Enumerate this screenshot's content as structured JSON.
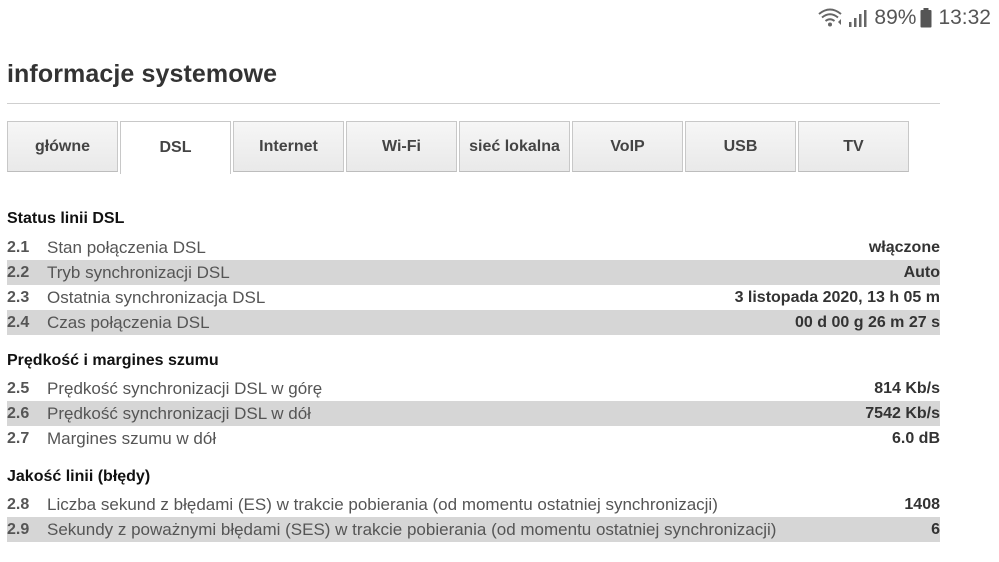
{
  "status_bar": {
    "battery_percent": "89%",
    "time": "13:32",
    "icons": [
      "wifi-icon",
      "signal-icon",
      "battery-icon"
    ]
  },
  "page": {
    "title": "informacje systemowe"
  },
  "tabs": [
    {
      "label": "główne"
    },
    {
      "label": "DSL"
    },
    {
      "label": "Internet"
    },
    {
      "label": "Wi-Fi"
    },
    {
      "label": "sieć lokalna"
    },
    {
      "label": "VoIP"
    },
    {
      "label": "USB"
    },
    {
      "label": "TV"
    }
  ],
  "active_tab": "DSL",
  "sections": [
    {
      "heading": "Status linii DSL",
      "rows": [
        {
          "num": "2.1",
          "label": "Stan połączenia DSL",
          "value": "włączone"
        },
        {
          "num": "2.2",
          "label": "Tryb synchronizacji DSL",
          "value": "Auto"
        },
        {
          "num": "2.3",
          "label": "Ostatnia synchronizacja DSL",
          "value": "3 listopada 2020, 13 h 05 m"
        },
        {
          "num": "2.4",
          "label": "Czas połączenia DSL",
          "value": "00 d 00 g 26 m 27 s"
        }
      ]
    },
    {
      "heading": "Prędkość i margines szumu",
      "rows": [
        {
          "num": "2.5",
          "label": "Prędkość synchronizacji DSL w górę",
          "value": "814 Kb/s"
        },
        {
          "num": "2.6",
          "label": "Prędkość synchronizacji DSL w dół",
          "value": "7542 Kb/s"
        },
        {
          "num": "2.7",
          "label": "Margines szumu w dół",
          "value": "6.0 dB"
        }
      ]
    },
    {
      "heading": "Jakość linii (błędy)",
      "rows": [
        {
          "num": "2.8",
          "label": "Liczba sekund z błędami (ES) w trakcie pobierania (od momentu ostatniej synchronizacji)",
          "value": "1408"
        },
        {
          "num": "2.9",
          "label": "Sekundy z poważnymi błędami (SES) w trakcie pobierania (od momentu ostatniej synchronizacji)",
          "value": "6"
        }
      ]
    }
  ]
}
